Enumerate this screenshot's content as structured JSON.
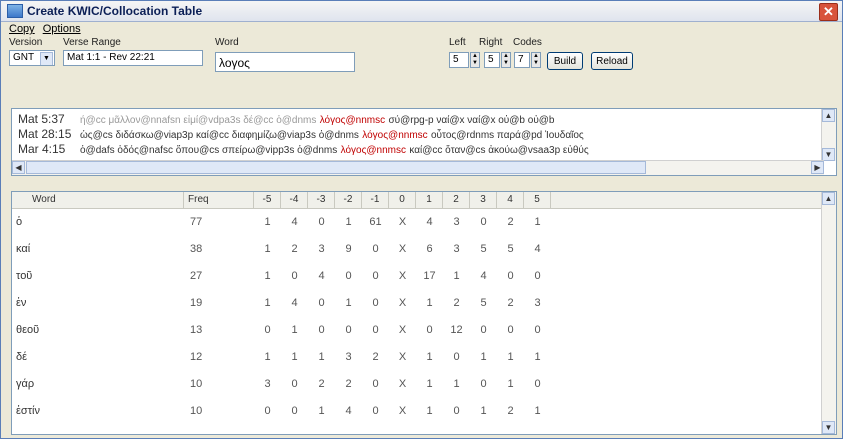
{
  "window": {
    "title": "Create KWIC/Collocation Table"
  },
  "menu": {
    "copy": "Copy",
    "options": "Options"
  },
  "controls": {
    "version_label": "Version",
    "version_value": "GNT",
    "verse_range_label": "Verse Range",
    "verse_range_value": "Mat 1:1 - Rev 22:21",
    "word_label": "Word",
    "word_value": "λογος",
    "left_label": "Left",
    "left_value": "5",
    "right_label": "Right",
    "right_value": "5",
    "codes_label": "Codes",
    "codes_value": "7",
    "build_label": "Build",
    "reload_label": "Reload"
  },
  "kwic": [
    {
      "ref": "Mat 5:37",
      "before": "ή@cc μᾶλλον@nnafsn εἰμί@vdpa3s δέ@cc ὁ@dnms",
      "keyword": "λόγος@nnmsc",
      "after": "σύ@rpg-p ναί@x ναί@x οὐ@b οὐ@b",
      "faded": true
    },
    {
      "ref": "Mat 28:15",
      "before": "ὡς@cs διδάσκω@viap3p καί@cc διαφημίζω@viap3s ὁ@dnms",
      "keyword": "λόγος@nnmsc",
      "after": "οὗτος@rdnms παρά@pd Ἰουδαῖος",
      "faded": false
    },
    {
      "ref": "Mar 4:15",
      "before": "ὁ@dafs ὁδός@nafsc ὅπου@cs σπείρω@vipp3s ὁ@dnms",
      "keyword": "λόγος@nnmsc",
      "after": "καί@cc ὅταν@cs ἀκούω@vsaa3p εὐθύς",
      "faded": false
    }
  ],
  "table": {
    "headers": [
      "Word",
      "Freq",
      "-5",
      "-4",
      "-3",
      "-2",
      "-1",
      "0",
      "1",
      "2",
      "3",
      "4",
      "5"
    ],
    "rows": [
      {
        "word": "ὁ",
        "freq": "77",
        "cols": [
          "1",
          "4",
          "0",
          "1",
          "61",
          "X",
          "4",
          "3",
          "0",
          "2",
          "1"
        ]
      },
      {
        "word": "καί",
        "freq": "38",
        "cols": [
          "1",
          "2",
          "3",
          "9",
          "0",
          "X",
          "6",
          "3",
          "5",
          "5",
          "4"
        ]
      },
      {
        "word": "τοῦ",
        "freq": "27",
        "cols": [
          "1",
          "0",
          "4",
          "0",
          "0",
          "X",
          "17",
          "1",
          "4",
          "0",
          "0"
        ]
      },
      {
        "word": "ἐν",
        "freq": "19",
        "cols": [
          "1",
          "4",
          "0",
          "1",
          "0",
          "X",
          "1",
          "2",
          "5",
          "2",
          "3"
        ]
      },
      {
        "word": "θεοῦ",
        "freq": "13",
        "cols": [
          "0",
          "1",
          "0",
          "0",
          "0",
          "X",
          "0",
          "12",
          "0",
          "0",
          "0"
        ]
      },
      {
        "word": "δέ",
        "freq": "12",
        "cols": [
          "1",
          "1",
          "1",
          "3",
          "2",
          "X",
          "1",
          "0",
          "1",
          "1",
          "1"
        ]
      },
      {
        "word": "γάρ",
        "freq": "10",
        "cols": [
          "3",
          "0",
          "2",
          "2",
          "0",
          "X",
          "1",
          "1",
          "0",
          "1",
          "0"
        ]
      },
      {
        "word": "ἐστίν",
        "freq": "10",
        "cols": [
          "0",
          "0",
          "1",
          "4",
          "0",
          "X",
          "1",
          "0",
          "1",
          "2",
          "1"
        ]
      }
    ]
  },
  "colors": {
    "keyword": "#c00000",
    "close_button": "#d8533b"
  }
}
